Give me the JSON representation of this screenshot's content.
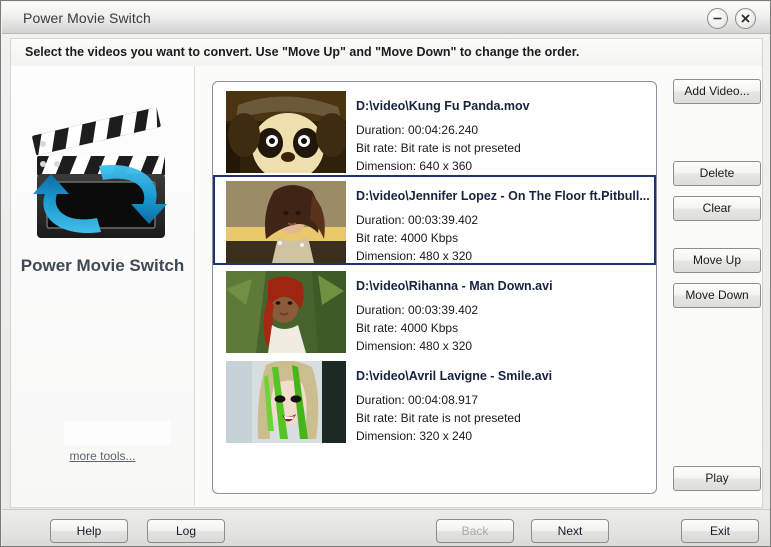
{
  "window": {
    "title": "Power Movie Switch",
    "minimize_icon": "minimize-icon",
    "close_icon": "close-icon"
  },
  "instruction": {
    "text": "Select the videos you want to convert. Use \"Move Up\" and \"Move Down\" to change the order."
  },
  "brand": {
    "logo_icon": "movie-clapperboard-convert-icon",
    "title": "Power Movie Switch",
    "more_tools_label": "more tools..."
  },
  "video_list": {
    "items": [
      {
        "thumbnail": "kung-fu-panda-thumbnail",
        "path": "D:\\video\\Kung Fu Panda.mov",
        "duration": "Duration: 00:04:26.240",
        "bitrate": "Bit rate: Bit rate is not preseted",
        "dimension": "Dimension: 640 x 360",
        "selected": false
      },
      {
        "thumbnail": "jennifer-lopez-thumbnail",
        "path": "D:\\video\\Jennifer Lopez - On The Floor ft.Pitbull...",
        "duration": "Duration: 00:03:39.402",
        "bitrate": "Bit rate: 4000 Kbps",
        "dimension": "Dimension: 480 x 320",
        "selected": true
      },
      {
        "thumbnail": "rihanna-thumbnail",
        "path": "D:\\video\\Rihanna - Man Down.avi",
        "duration": "Duration: 00:03:39.402",
        "bitrate": "Bit rate: 4000 Kbps",
        "dimension": "Dimension: 480 x 320",
        "selected": false
      },
      {
        "thumbnail": "avril-lavigne-thumbnail",
        "path": "D:\\video\\Avril Lavigne - Smile.avi",
        "duration": "Duration: 00:04:08.917",
        "bitrate": "Bit rate: Bit rate is not preseted",
        "dimension": "Dimension: 320 x 240",
        "selected": false
      }
    ]
  },
  "side_buttons": {
    "add_video": "Add Video...",
    "delete": "Delete",
    "clear": "Clear",
    "move_up": "Move Up",
    "move_down": "Move Down",
    "play": "Play"
  },
  "footer": {
    "help": "Help",
    "log": "Log",
    "back": "Back",
    "next": "Next",
    "exit": "Exit",
    "back_disabled": true
  },
  "colors": {
    "selection_border": "#1f3271",
    "title_text": "#16233e",
    "brand_text": "#3f4a55",
    "window_bg": "#f2f2f0"
  }
}
